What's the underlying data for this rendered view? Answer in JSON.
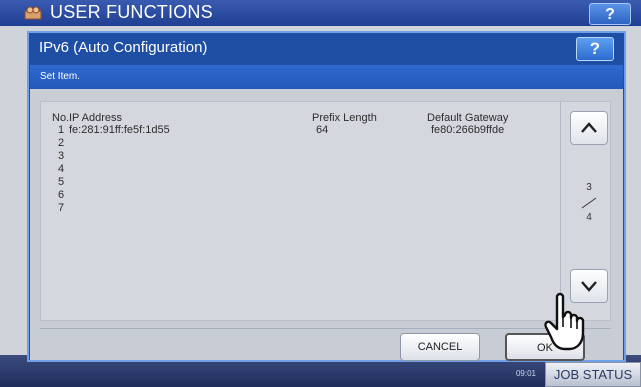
{
  "background": {
    "title": "USER FUNCTIONS",
    "help_label": "?",
    "job_status_label": "JOB STATUS",
    "time": "09:01"
  },
  "dialog": {
    "title": "IPv6 (Auto Configuration)",
    "help_label": "?",
    "subtitle": "Set Item.",
    "columns": {
      "no": "No.",
      "ip": "IP Address",
      "prefix": "Prefix Length",
      "gateway": "Default Gateway"
    },
    "rows": [
      {
        "no": "1",
        "ip": "fe:281:91ff:fe5f:1d55",
        "prefix": "64",
        "gateway": "fe80:266b9ffde"
      },
      {
        "no": "2",
        "ip": "",
        "prefix": "",
        "gateway": ""
      },
      {
        "no": "3",
        "ip": "",
        "prefix": "",
        "gateway": ""
      },
      {
        "no": "4",
        "ip": "",
        "prefix": "",
        "gateway": ""
      },
      {
        "no": "5",
        "ip": "",
        "prefix": "",
        "gateway": ""
      },
      {
        "no": "6",
        "ip": "",
        "prefix": "",
        "gateway": ""
      },
      {
        "no": "7",
        "ip": "",
        "prefix": "",
        "gateway": ""
      }
    ],
    "page_current": "3",
    "page_total": "4",
    "cancel_label": "CANCEL",
    "ok_label": "OK"
  },
  "colors": {
    "header_blue": "#1f4fa5",
    "strip_blue": "#2f6ad0",
    "body_gray": "#c7ccd5"
  }
}
